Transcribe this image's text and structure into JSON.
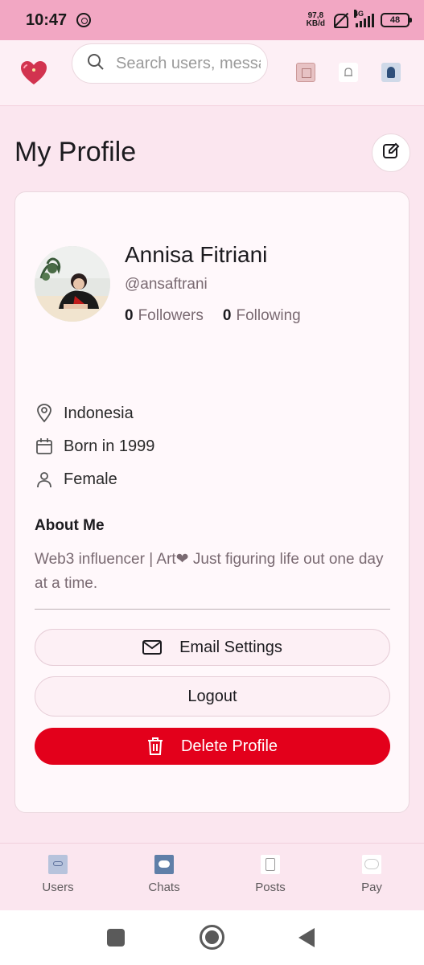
{
  "status_bar": {
    "time": "10:47",
    "net_speed_value": "97,8",
    "net_speed_unit": "KB/d",
    "network_type": "4G",
    "battery": "48"
  },
  "header": {
    "search_placeholder": "Search users, messages..."
  },
  "page": {
    "title": "My Profile"
  },
  "profile": {
    "name": "Annisa Fitriani",
    "handle": "@ansaftrani",
    "followers_count": "0",
    "followers_label": "Followers",
    "following_count": "0",
    "following_label": "Following",
    "location": "Indonesia",
    "birth": "Born in 1999",
    "gender": "Female",
    "about_title": "About Me",
    "about_text": "Web3 influencer | Art❤ Just figuring life out one day at a time."
  },
  "actions": {
    "email_settings": "Email Settings",
    "logout": "Logout",
    "delete_profile": "Delete Profile"
  },
  "nav": {
    "items": [
      {
        "label": "Users"
      },
      {
        "label": "Chats"
      },
      {
        "label": "Posts"
      },
      {
        "label": "Pay"
      }
    ]
  },
  "colors": {
    "accent_pink": "#f2a7c3",
    "danger": "#e3001b",
    "background": "#fbe6ef"
  }
}
